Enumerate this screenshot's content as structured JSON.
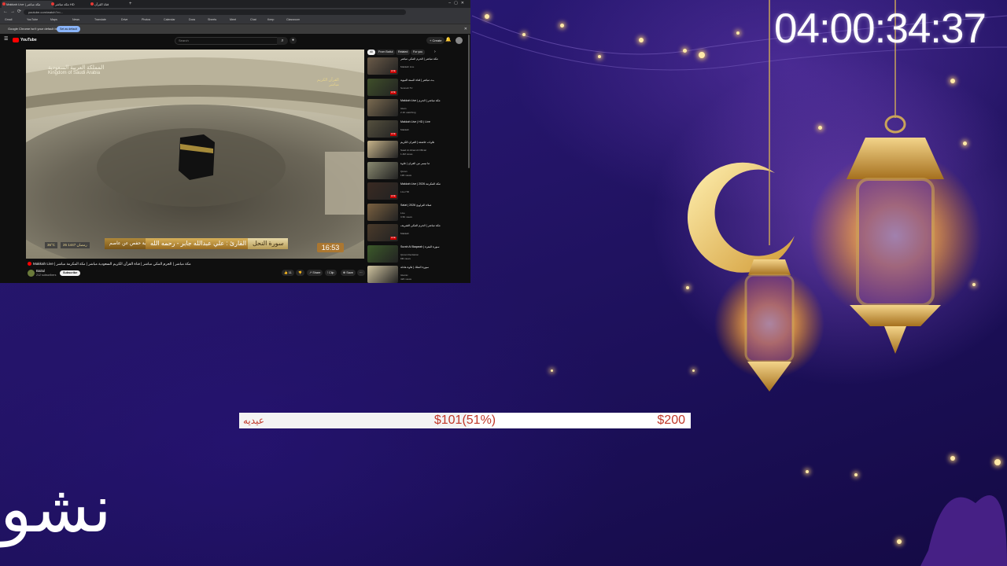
{
  "browser": {
    "tabs": [
      {
        "label": "Makkah Live | مكة مباشر",
        "active": true
      },
      {
        "label": "مكة مباشر HD",
        "active": false
      },
      {
        "label": "قناة القرآن",
        "active": false
      }
    ],
    "address": "youtube.com/watch?v=...",
    "bookmarks": [
      "Gmail",
      "YouTube",
      "Maps",
      "News",
      "Translate",
      "Drive",
      "Photos",
      "Calendar",
      "Docs",
      "Sheets",
      "Meet",
      "Chat",
      "Keep",
      "Classroom"
    ],
    "infobar_message": "Google Chrome isn't your default browser",
    "infobar_button": "Set as default"
  },
  "youtube": {
    "logo_text": "YouTube",
    "search_placeholder": "Search",
    "create_label": "+ Create",
    "video": {
      "overlay_ar": "المملكة العربية السعودية",
      "overlay_en": "Kingdom of Saudi Arabia",
      "quran_badge_1": "القرآن الكريم",
      "quran_badge_2": "مباشر",
      "reader": "القارئ : علي عبدالله جابر - رحمه الله",
      "surah": "سورة النحل",
      "riwaya": "رواية حفص عن عاصم",
      "temp": "36°C",
      "date": "26 رمضان 1447",
      "clock": "16:53"
    },
    "title": "Makkah Live | مكة مباشر | الحرم المكي مباشر | قناة القرآن الكريم السعودية مباشر | مكة المكرمة مباشر",
    "channel": "Baitul",
    "subscribers": "212 subscribers",
    "subscribe": "Subscribe",
    "actions": [
      "👍 11",
      "👎",
      "↗ Share",
      "⫶ Clip",
      "⊕ Save",
      "⋯"
    ],
    "chips": [
      "All",
      "From Baitul",
      "Related",
      "For you"
    ],
    "recommendations": [
      {
        "title": "مكة مباشر | الحرم المكي مباشر",
        "channel": "Makkah Live",
        "meta": "LIVE",
        "tone": "#6a5a48"
      },
      {
        "title": "بث مباشر | قناة السنة النبوية",
        "channel": "Sunnah TV",
        "meta": "LIVE",
        "tone": "#3f4f2a"
      },
      {
        "title": "Makkah Live | مكة مباشر | الحرم",
        "channel": "Islam",
        "meta": "2.1K watching",
        "tone": "#7a6a50"
      },
      {
        "title": "Makkah Live | HD | Live",
        "channel": "Makkah",
        "meta": "LIVE",
        "tone": "#55503e"
      },
      {
        "title": "تلاوات خاشعة | القرآن الكريم",
        "channel": "Saad Al-Ghamdi Official",
        "meta": "1.2M views",
        "tone": "#c7b48a"
      },
      {
        "title": "ما تيسر من القرآن | تلاوة",
        "channel": "Quran",
        "meta": "19K views",
        "tone": "#8a8a70"
      },
      {
        "title": "Makkah Live | مكة المكرمة 2026",
        "channel": "Live HD",
        "meta": "LIVE",
        "tone": "#3a2a22"
      },
      {
        "title": "Salat | صلاة التراويح 2026",
        "channel": "Live",
        "meta": "3.5K views",
        "tone": "#7a6040"
      },
      {
        "title": "مكة مباشر | الحرم المكي الشريف",
        "channel": "Makkah",
        "meta": "LIVE",
        "tone": "#4a3a2a"
      },
      {
        "title": "Surah Al Baqarah | سورة البقرة",
        "channel": "Quran Recitation",
        "meta": "8M views",
        "tone": "#3c5a2a"
      },
      {
        "title": "سورة الملك | تلاوة هادئة",
        "channel": "Islamic",
        "meta": "42K views",
        "tone": "#d0c4a0"
      }
    ]
  },
  "overlay": {
    "timer": "04:00:34:37",
    "goal": {
      "label": "عيديه",
      "progress_text": "$101(51%)",
      "target": "$200",
      "fraction": 0.51
    },
    "bottom_text": "نشو"
  }
}
